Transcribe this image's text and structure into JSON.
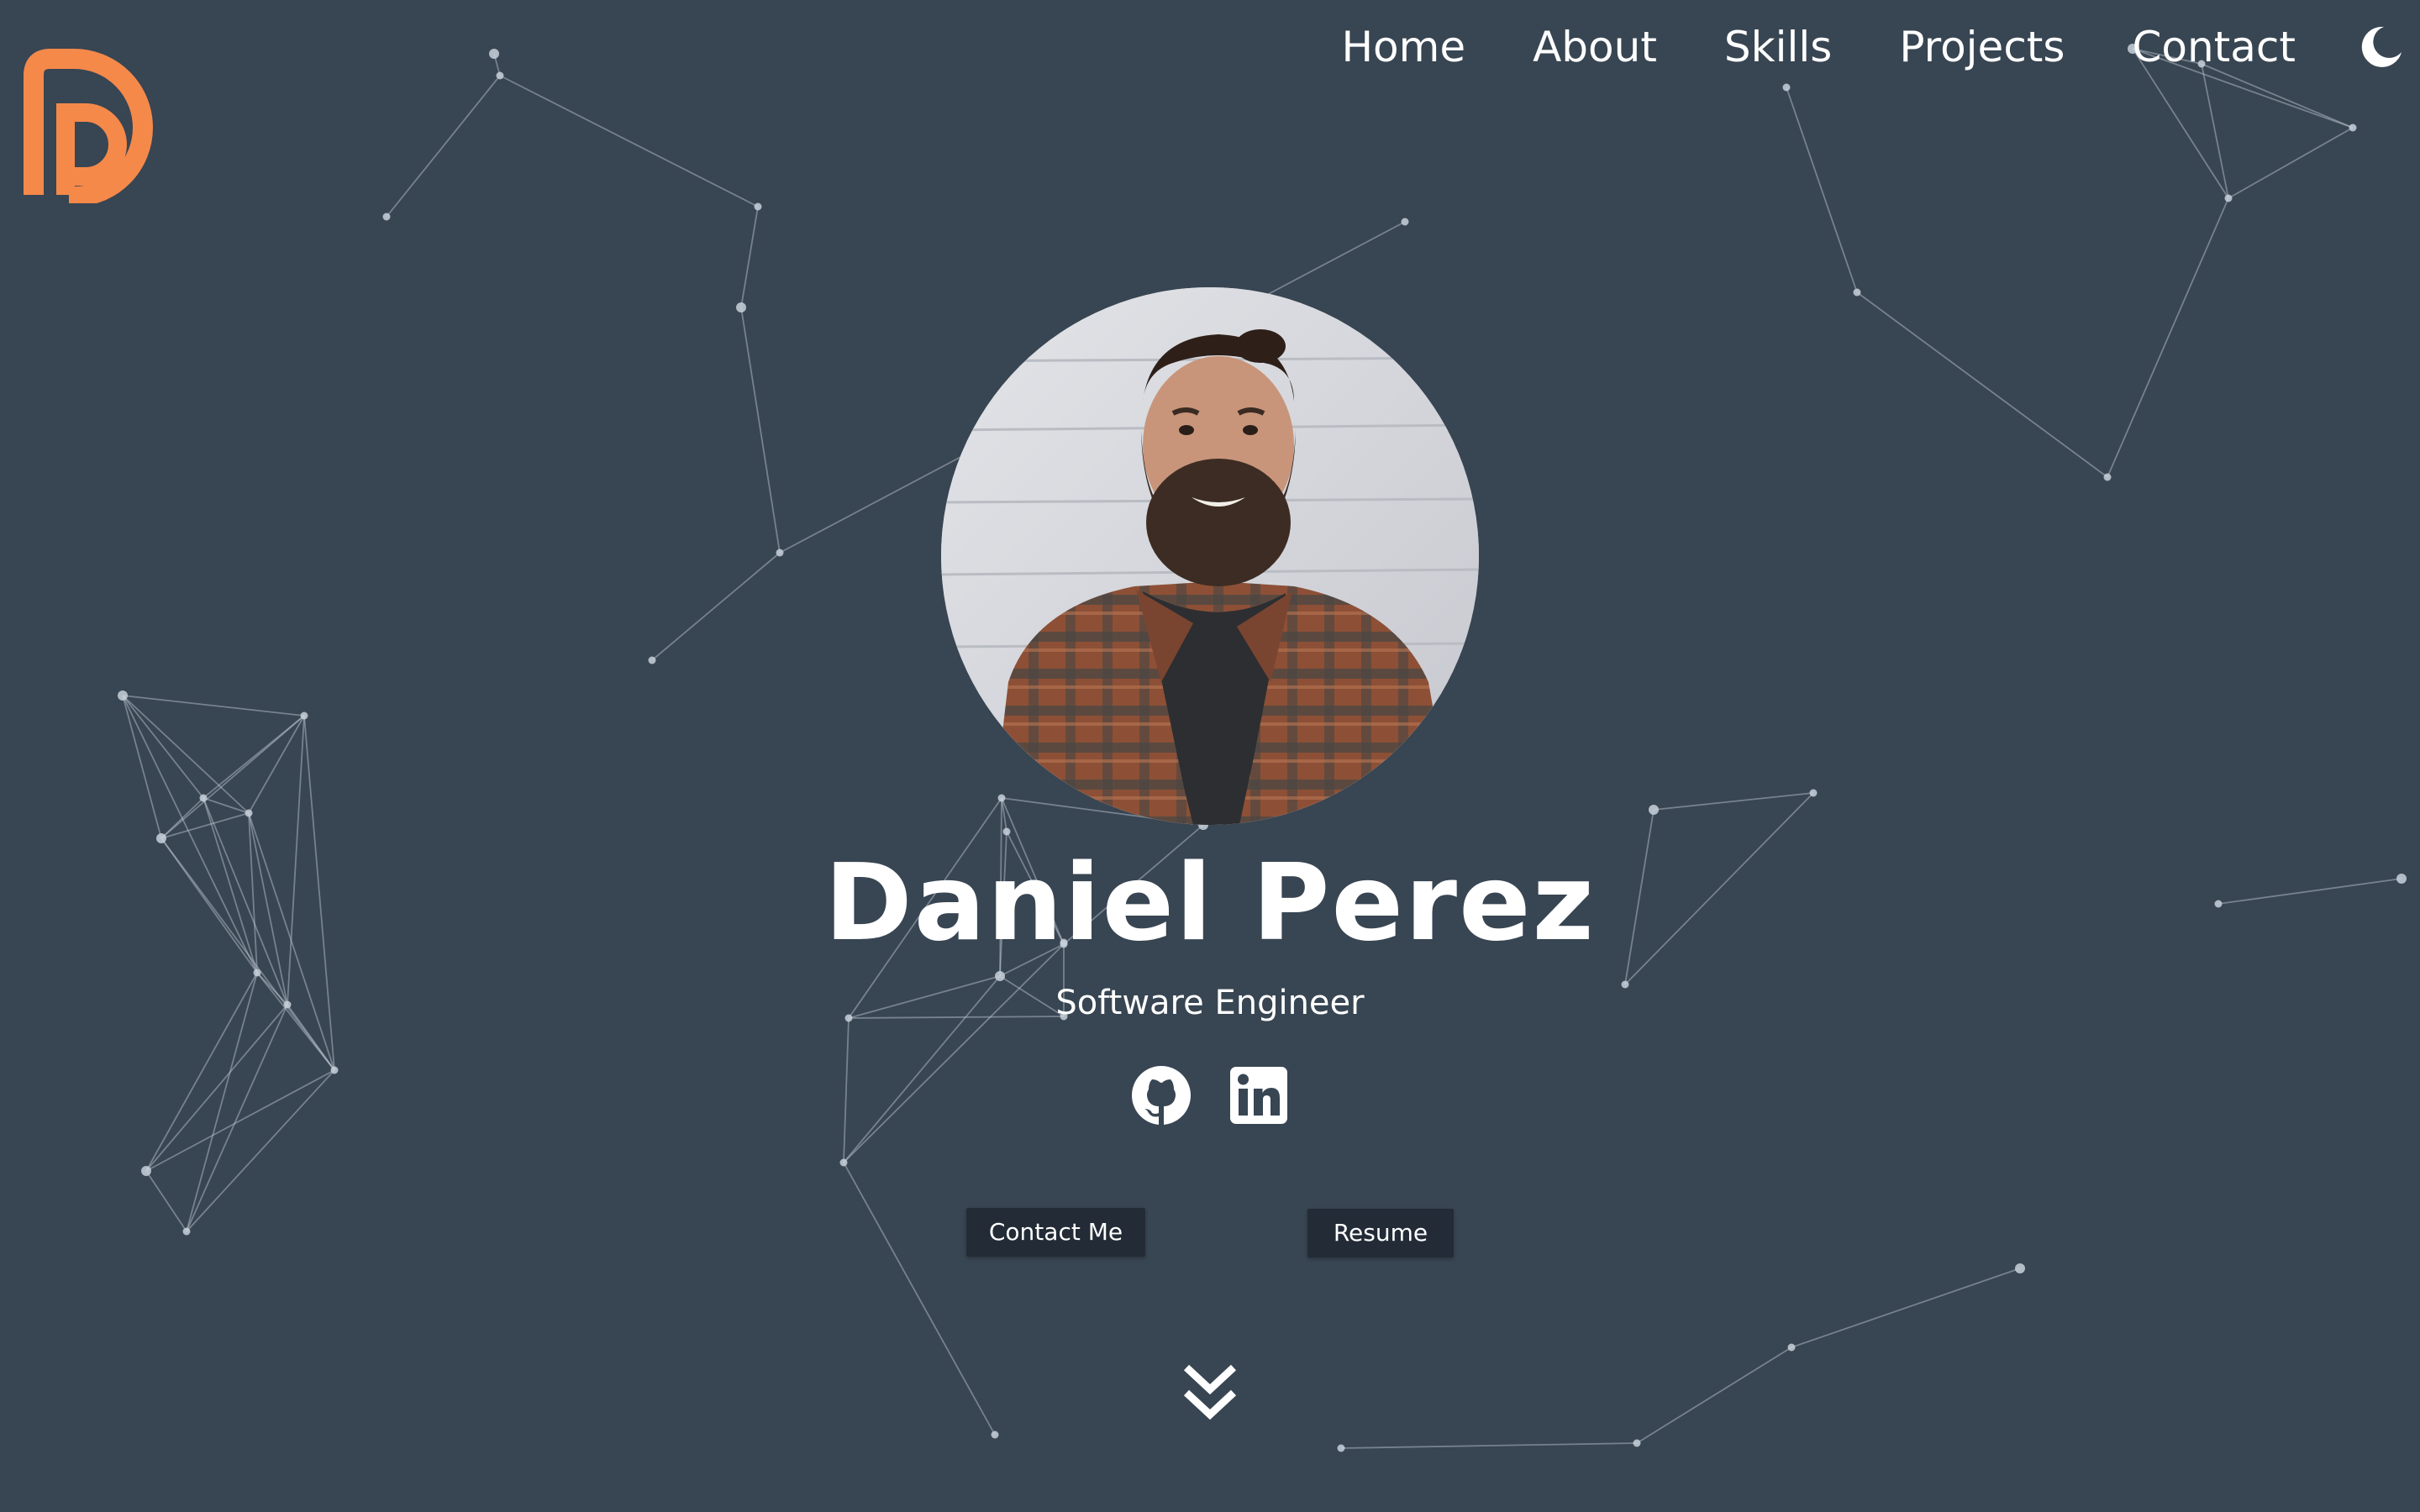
{
  "nav": {
    "logo": "DP",
    "links": [
      {
        "label": "Home"
      },
      {
        "label": "About"
      },
      {
        "label": "Skills"
      },
      {
        "label": "Projects"
      },
      {
        "label": "Contact"
      }
    ],
    "theme_toggle_icon": "moon-icon"
  },
  "hero": {
    "name": "Daniel Perez",
    "role": "Software Engineer",
    "socials": [
      {
        "icon": "github-icon"
      },
      {
        "icon": "linkedin-icon"
      }
    ],
    "buttons": {
      "contact_label": "Contact Me",
      "resume_label": "Resume"
    },
    "scroll_icon": "double-chevron-down-icon"
  },
  "colors": {
    "background": "#384552",
    "logo_accent": "#F5894A",
    "button_bg": "#222B36",
    "text": "#FFFFFF"
  }
}
